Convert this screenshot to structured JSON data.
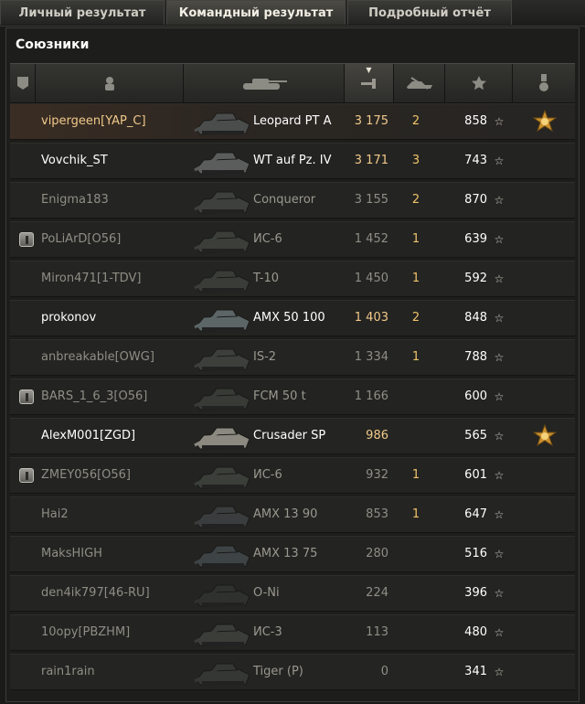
{
  "tabs": [
    {
      "label": "Личный результат",
      "active": false
    },
    {
      "label": "Командный результат",
      "active": true
    },
    {
      "label": "Подробный отчёт",
      "active": false
    }
  ],
  "team_label": "Союзники",
  "header": {
    "sorted_column": "damage",
    "icons": [
      "platoon-icon",
      "player-icon",
      "tank-icon",
      "damage-icon",
      "kills-icon",
      "xp-star-icon",
      "medal-icon"
    ]
  },
  "rows": [
    {
      "player": "vipergeen[YAP_C]",
      "vehicle": "Leopard PT A",
      "damage": "3 175",
      "kills": "2",
      "xp": "858",
      "platoon": false,
      "medal": true,
      "style": "highlight",
      "name_color": "#f1c98a",
      "value_color": "#f1c98a"
    },
    {
      "player": "Vovchik_ST",
      "vehicle": "WT auf Pz. IV",
      "damage": "3 171",
      "kills": "3",
      "xp": "743",
      "platoon": false,
      "medal": false,
      "style": "normal",
      "name_color": "#ffffff",
      "value_color": "#f1c98a"
    },
    {
      "player": "Enigma183",
      "vehicle": "Conqueror",
      "damage": "3 155",
      "kills": "2",
      "xp": "870",
      "platoon": false,
      "medal": false,
      "style": "dim",
      "name_color": "#8f8d85",
      "value_color": "#8f8d85"
    },
    {
      "player": "PoLiArD[O56]",
      "vehicle": "ИС-6",
      "damage": "1 452",
      "kills": "1",
      "xp": "639",
      "platoon": true,
      "medal": false,
      "style": "dim",
      "name_color": "#8f8d85",
      "value_color": "#8f8d85"
    },
    {
      "player": "Miron471[1-TDV]",
      "vehicle": "T-10",
      "damage": "1 450",
      "kills": "1",
      "xp": "592",
      "platoon": false,
      "medal": false,
      "style": "dim",
      "name_color": "#8f8d85",
      "value_color": "#8f8d85"
    },
    {
      "player": "prokonov",
      "vehicle": "AMX 50 100",
      "damage": "1 403",
      "kills": "2",
      "xp": "848",
      "platoon": false,
      "medal": false,
      "style": "normal",
      "name_color": "#ffffff",
      "value_color": "#f1c98a"
    },
    {
      "player": "anbreakable[OWG]",
      "vehicle": "IS-2",
      "damage": "1 334",
      "kills": "1",
      "xp": "788",
      "platoon": false,
      "medal": false,
      "style": "dim",
      "name_color": "#8f8d85",
      "value_color": "#8f8d85"
    },
    {
      "player": "BARS_1_6_3[O56]",
      "vehicle": "FCM 50 t",
      "damage": "1 166",
      "kills": "",
      "xp": "600",
      "platoon": true,
      "medal": false,
      "style": "dim",
      "name_color": "#8f8d85",
      "value_color": "#8f8d85"
    },
    {
      "player": "AlexM001[ZGD]",
      "vehicle": "Crusader SP",
      "damage": "986",
      "kills": "",
      "xp": "565",
      "platoon": false,
      "medal": true,
      "style": "normal",
      "name_color": "#ffffff",
      "value_color": "#f1c98a"
    },
    {
      "player": "ZMEY056[O56]",
      "vehicle": "ИС-6",
      "damage": "932",
      "kills": "1",
      "xp": "601",
      "platoon": true,
      "medal": false,
      "style": "dim",
      "name_color": "#8f8d85",
      "value_color": "#8f8d85"
    },
    {
      "player": "Hai2",
      "vehicle": "AMX 13 90",
      "damage": "853",
      "kills": "1",
      "xp": "647",
      "platoon": false,
      "medal": false,
      "style": "dim",
      "name_color": "#8f8d85",
      "value_color": "#8f8d85"
    },
    {
      "player": "MaksHIGH",
      "vehicle": "AMX 13 75",
      "damage": "280",
      "kills": "",
      "xp": "516",
      "platoon": false,
      "medal": false,
      "style": "dim",
      "name_color": "#8f8d85",
      "value_color": "#8f8d85"
    },
    {
      "player": "den4ik797[46-RU]",
      "vehicle": "O-Ni",
      "damage": "224",
      "kills": "",
      "xp": "396",
      "platoon": false,
      "medal": false,
      "style": "dim",
      "name_color": "#8f8d85",
      "value_color": "#8f8d85"
    },
    {
      "player": "10opy[PBZHM]",
      "vehicle": "ИС-3",
      "damage": "113",
      "kills": "",
      "xp": "480",
      "platoon": false,
      "medal": false,
      "style": "dim",
      "name_color": "#8f8d85",
      "value_color": "#8f8d85"
    },
    {
      "player": "rain1rain",
      "vehicle": "Tiger (P)",
      "damage": "0",
      "kills": "",
      "xp": "341",
      "platoon": false,
      "medal": false,
      "style": "dim",
      "name_color": "#8f8d85",
      "value_color": "#8f8d85"
    }
  ]
}
